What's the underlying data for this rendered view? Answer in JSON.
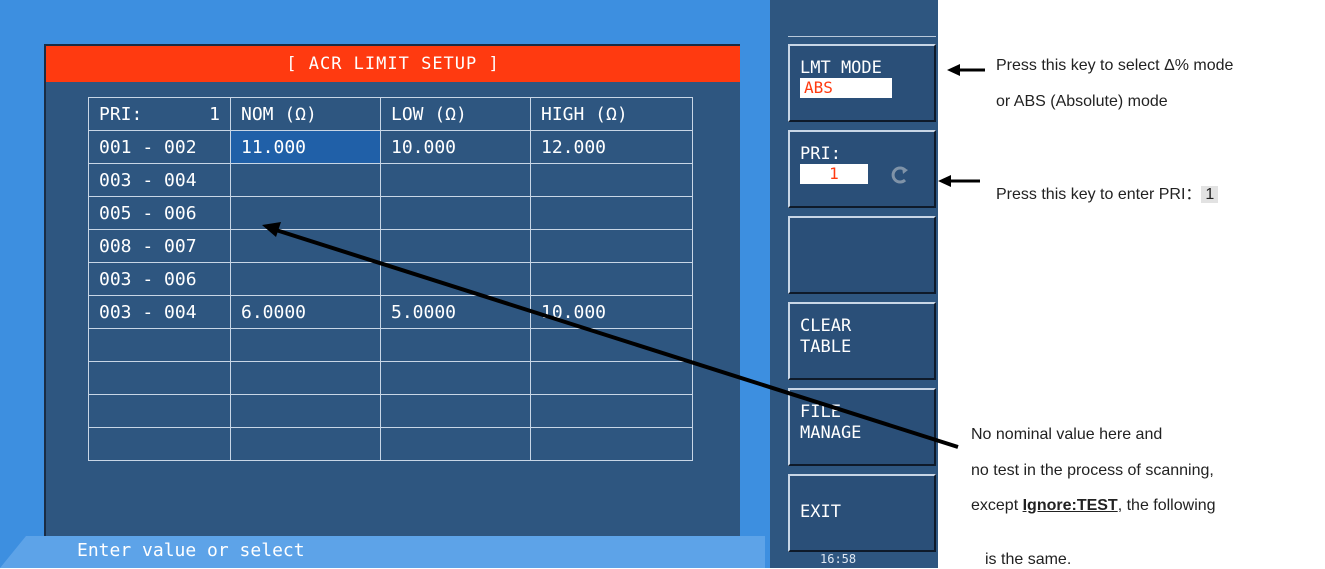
{
  "screen": {
    "title": "[ ACR LIMIT SETUP ]",
    "table": {
      "header": {
        "pri_label": "PRI:",
        "pri_value": "1",
        "nom": "NOM  (Ω)",
        "low": "LOW  (Ω)",
        "high": "HIGH (Ω)"
      },
      "rows": [
        {
          "pins": "001 - 002",
          "nom": "11.000",
          "low": "10.000",
          "high": "12.000"
        },
        {
          "pins": "003 - 004",
          "nom": "",
          "low": "",
          "high": ""
        },
        {
          "pins": "005 - 006",
          "nom": "",
          "low": "",
          "high": ""
        },
        {
          "pins": "008 - 007",
          "nom": "",
          "low": "",
          "high": ""
        },
        {
          "pins": "003 - 006",
          "nom": "",
          "low": "",
          "high": ""
        },
        {
          "pins": "003 - 004",
          "nom": "6.0000",
          "low": "5.0000",
          "high": "10.000"
        },
        {
          "pins": "",
          "nom": "",
          "low": "",
          "high": ""
        },
        {
          "pins": "",
          "nom": "",
          "low": "",
          "high": ""
        },
        {
          "pins": "",
          "nom": "",
          "low": "",
          "high": ""
        },
        {
          "pins": "",
          "nom": "",
          "low": "",
          "high": ""
        }
      ]
    },
    "status": "Enter value or select",
    "softkeys": {
      "lmt_mode": {
        "label": "LMT MODE",
        "value": "ABS"
      },
      "pri": {
        "label": "PRI:",
        "value": "1"
      },
      "clear": {
        "line1": "CLEAR",
        "line2": "TABLE"
      },
      "file": {
        "line1": "FILE",
        "line2": "MANAGE"
      },
      "exit": {
        "label": "EXIT"
      }
    },
    "clock": "16:58"
  },
  "annotations": {
    "lmt_mode_line1": "Press this key to select Δ% mode",
    "lmt_mode_line2": "or ABS (Absolute) mode",
    "pri_prefix": "Press this key to enter PRI：",
    "pri_value": "1",
    "nominal_line1": "No nominal value here and",
    "nominal_line2": "no test in the process of scanning,",
    "nominal_line3_pre": "except ",
    "nominal_line3_bold": "Ignore:TEST",
    "nominal_line3_post": ", the following",
    "nominal_line4": "is the same."
  },
  "colors": {
    "title_bar": "#ff3a10",
    "panel": "#2e5680",
    "screen_bg": "#3d8fe0",
    "selected_cell": "#2060a8"
  }
}
